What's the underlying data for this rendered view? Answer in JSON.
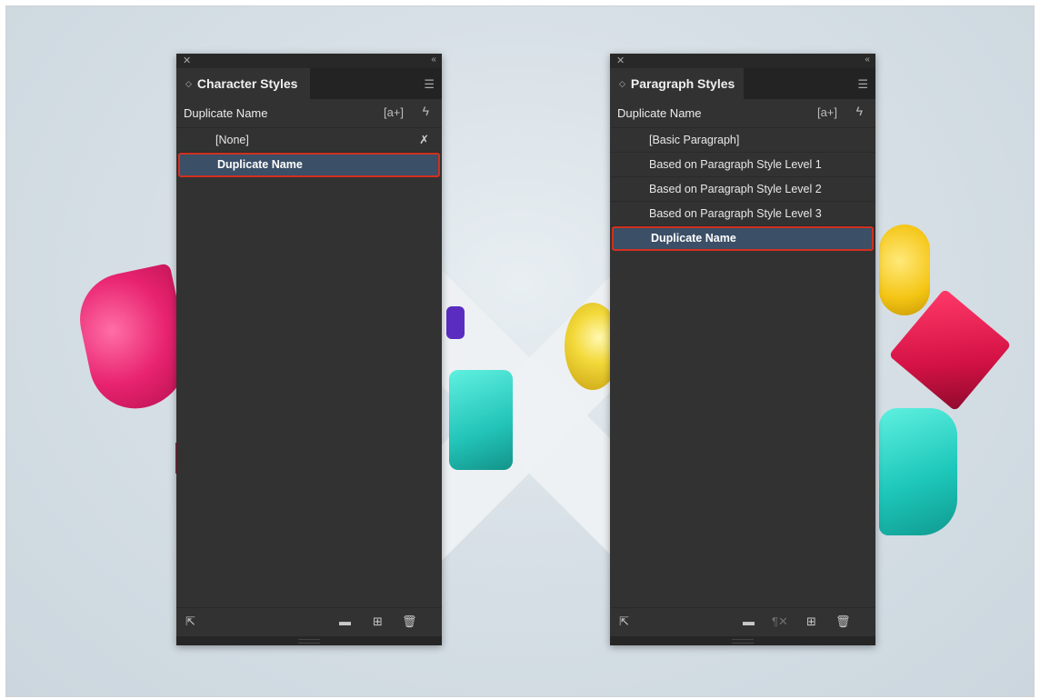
{
  "character_styles": {
    "title": "Character Styles",
    "current_style": "Duplicate Name",
    "new_indicator": "[a+]",
    "items": [
      {
        "label": "[None]"
      },
      {
        "label": "Duplicate Name",
        "selected": true
      }
    ]
  },
  "paragraph_styles": {
    "title": "Paragraph Styles",
    "current_style": "Duplicate Name",
    "new_indicator": "[a+]",
    "items": [
      {
        "label": "[Basic Paragraph]"
      },
      {
        "label": "Based on Paragraph Style Level 1"
      },
      {
        "label": "Based on Paragraph Style Level 2"
      },
      {
        "label": "Based on Paragraph Style Level 3"
      },
      {
        "label": "Duplicate Name",
        "selected": true
      }
    ]
  },
  "icons": {
    "close": "close-icon",
    "collapse": "collapse-icon",
    "menu": "panel-menu-icon",
    "lightning": "quick-apply-icon",
    "clear_overrides": "clear-overrides-icon",
    "load_styles": "load-styles-icon",
    "folder": "new-group-icon",
    "new_style": "new-style-icon",
    "delete": "delete-icon",
    "pilcrow": "clear-paragraph-overrides-icon"
  },
  "colors": {
    "panel_bg": "#323232",
    "selection_bg": "#3b4f66",
    "highlight_outline": "#d1301f"
  }
}
